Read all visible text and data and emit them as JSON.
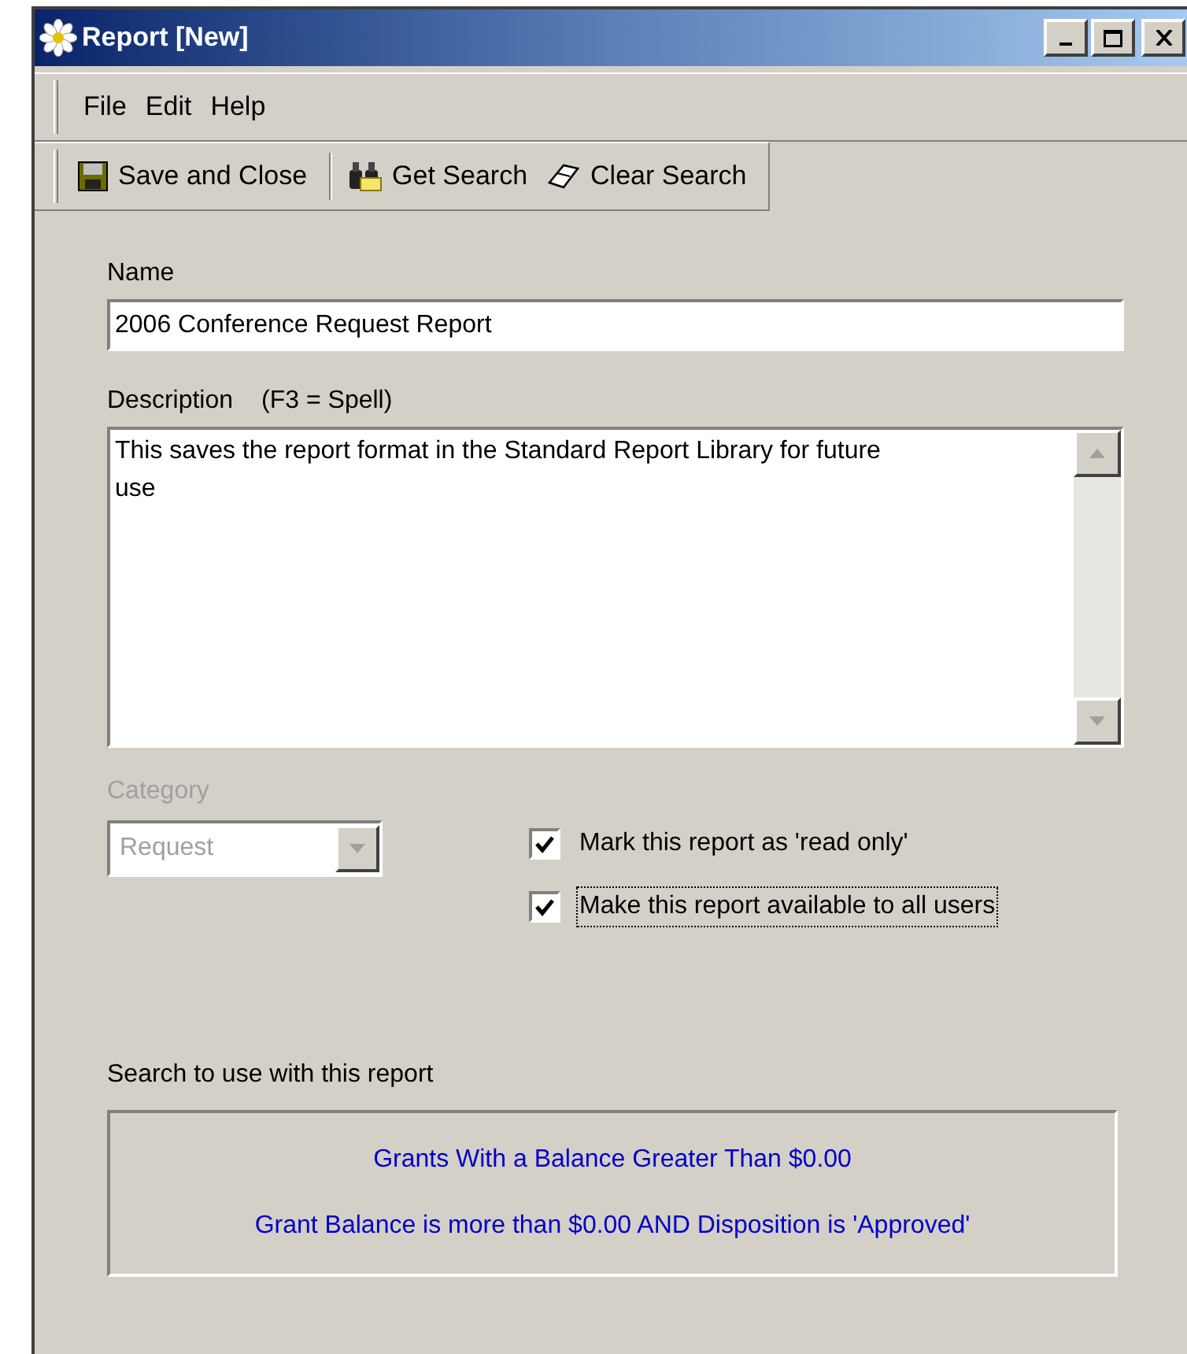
{
  "window": {
    "title": "Report [New]"
  },
  "menu": [
    "File",
    "Edit",
    "Help"
  ],
  "toolbar": [
    {
      "label": "Save and Close",
      "kind": "save"
    },
    {
      "label": "Get Search",
      "kind": "search"
    },
    {
      "label": "Clear Search",
      "kind": "clear"
    }
  ],
  "name_field": {
    "label": "Name",
    "value": "2006 Conference Request Report"
  },
  "description": {
    "label": "Description",
    "hint": "(F3 = Spell)",
    "value": "This saves the report format in the Standard Report Library for future use"
  },
  "category": {
    "label": "Category",
    "value": "Request",
    "disabled": true
  },
  "options": [
    {
      "label": "Mark this report as 'read only'",
      "checked": true,
      "focused": false
    },
    {
      "label": "Make this report available to all users",
      "checked": true,
      "focused": true
    }
  ],
  "search": {
    "label": "Search to use with this report",
    "title": "Grants With a Balance Greater Than $0.00",
    "criteria": "Grant Balance is more than $0.00 AND Disposition is 'Approved'"
  }
}
